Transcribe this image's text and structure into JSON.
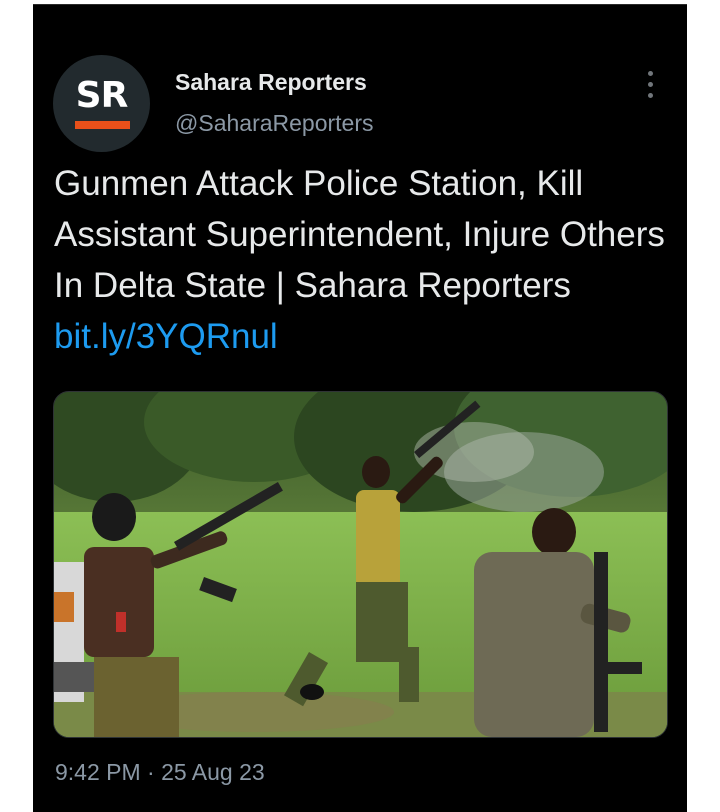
{
  "author": {
    "avatar_initials": "SR",
    "display_name": "Sahara Reporters",
    "handle": "@SaharaReporters"
  },
  "tweet": {
    "text": "Gunmen Attack Police Station, Kill Assistant Superintendent, Injure Others In Delta State | Sahara Reporters ",
    "link": "bit.ly/3YQRnul"
  },
  "media": {
    "description_icon": "photo"
  },
  "meta": {
    "timestamp": "9:42 PM · 25 Aug 23"
  },
  "colors": {
    "background": "#000000",
    "text": "#e7e9ea",
    "secondary": "#8b98a5",
    "link": "#1d9bf0",
    "brand_accent": "#e8501a"
  }
}
